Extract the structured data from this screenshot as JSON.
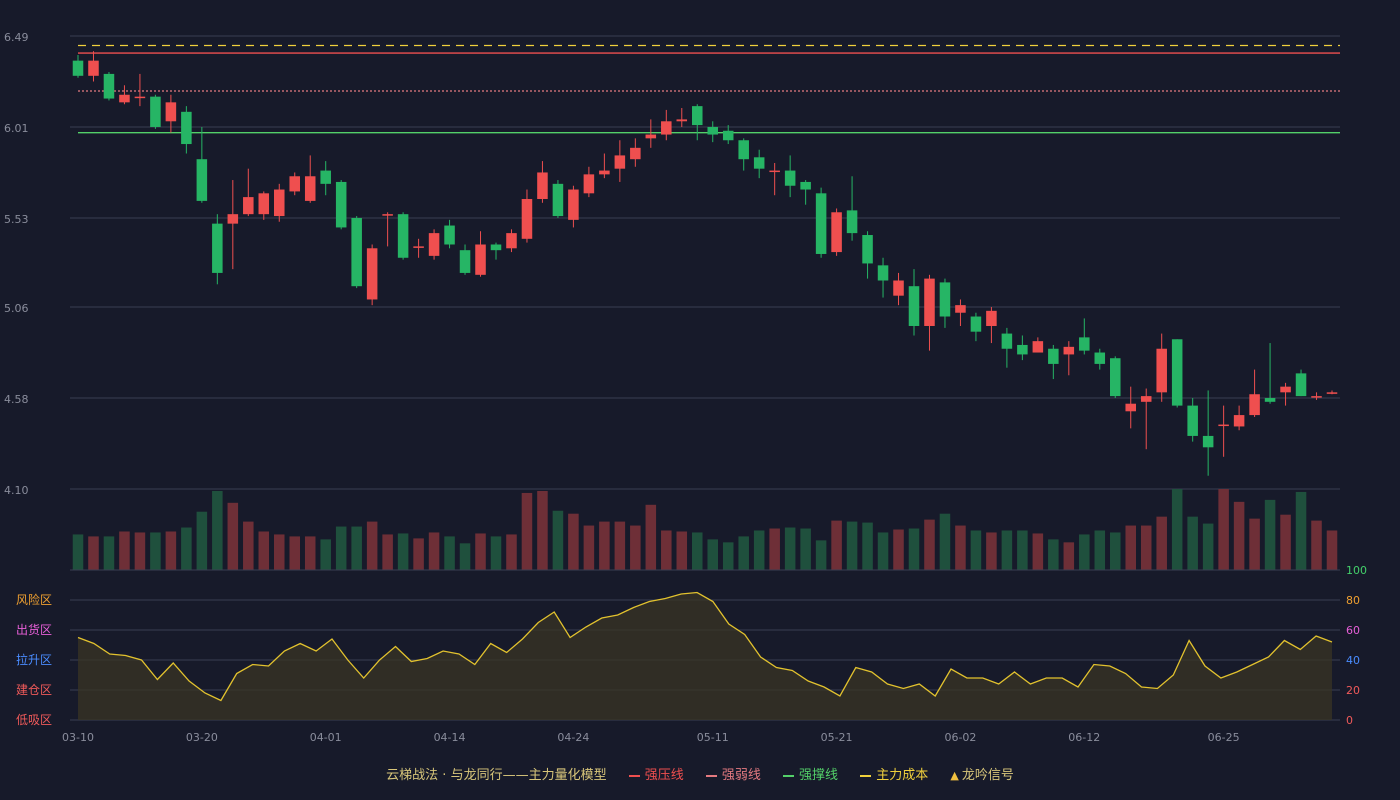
{
  "chart_data": {
    "type": "candlestick",
    "x": [
      "03-10",
      "03-11",
      "03-12",
      "03-13",
      "03-14",
      "03-17",
      "03-18",
      "03-19",
      "03-20",
      "03-21",
      "03-24",
      "03-25",
      "03-26",
      "03-27",
      "03-28",
      "03-31",
      "04-01",
      "04-02",
      "04-03",
      "04-07",
      "04-08",
      "04-09",
      "04-10",
      "04-11",
      "04-14",
      "04-15",
      "04-16",
      "04-17",
      "04-18",
      "04-21",
      "04-22",
      "04-23",
      "04-24",
      "04-25",
      "04-28",
      "04-29",
      "04-30",
      "05-06",
      "05-07",
      "05-08",
      "05-09",
      "05-11",
      "05-12",
      "05-13",
      "05-14",
      "05-15",
      "05-16",
      "05-19",
      "05-20",
      "05-21",
      "05-22",
      "05-23",
      "05-26",
      "05-27",
      "05-28",
      "05-29",
      "05-30",
      "06-02",
      "06-03",
      "06-04",
      "06-05",
      "06-06",
      "06-09",
      "06-10",
      "06-11",
      "06-12",
      "06-13",
      "06-16",
      "06-17",
      "06-18",
      "06-19",
      "06-20",
      "06-23",
      "06-24",
      "06-25",
      "06-26",
      "06-27",
      "06-30",
      "07-01",
      "07-02",
      "07-03",
      "07-04"
    ],
    "xticks": [
      "03-10",
      "03-20",
      "04-01",
      "04-14",
      "04-24",
      "05-11",
      "05-21",
      "06-02",
      "06-12",
      "06-25"
    ],
    "candles": [
      [
        6.36,
        6.28,
        6.39,
        6.27
      ],
      [
        6.28,
        6.36,
        6.41,
        6.25
      ],
      [
        6.29,
        6.16,
        6.3,
        6.15
      ],
      [
        6.14,
        6.18,
        6.23,
        6.13
      ],
      [
        6.17,
        6.17,
        6.29,
        6.12
      ],
      [
        6.17,
        6.01,
        6.18,
        6.0
      ],
      [
        6.04,
        6.14,
        6.18,
        5.98
      ],
      [
        6.09,
        5.92,
        6.12,
        5.87
      ],
      [
        5.84,
        5.62,
        6.01,
        5.61
      ],
      [
        5.5,
        5.24,
        5.55,
        5.18
      ],
      [
        5.5,
        5.55,
        5.73,
        5.26
      ],
      [
        5.55,
        5.64,
        5.79,
        5.54
      ],
      [
        5.55,
        5.66,
        5.67,
        5.52
      ],
      [
        5.54,
        5.68,
        5.71,
        5.51
      ],
      [
        5.67,
        5.75,
        5.77,
        5.65
      ],
      [
        5.62,
        5.75,
        5.86,
        5.61
      ],
      [
        5.78,
        5.71,
        5.83,
        5.65
      ],
      [
        5.72,
        5.48,
        5.73,
        5.47
      ],
      [
        5.53,
        5.17,
        5.54,
        5.16
      ],
      [
        5.1,
        5.37,
        5.39,
        5.07
      ],
      [
        5.55,
        5.55,
        5.56,
        5.38
      ],
      [
        5.55,
        5.32,
        5.56,
        5.31
      ],
      [
        5.38,
        5.38,
        5.42,
        5.32
      ],
      [
        5.33,
        5.45,
        5.47,
        5.31
      ],
      [
        5.49,
        5.39,
        5.52,
        5.37
      ],
      [
        5.36,
        5.24,
        5.39,
        5.23
      ],
      [
        5.23,
        5.39,
        5.46,
        5.22
      ],
      [
        5.39,
        5.36,
        5.4,
        5.31
      ],
      [
        5.37,
        5.45,
        5.47,
        5.35
      ],
      [
        5.42,
        5.63,
        5.68,
        5.4
      ],
      [
        5.63,
        5.77,
        5.83,
        5.61
      ],
      [
        5.71,
        5.54,
        5.73,
        5.53
      ],
      [
        5.52,
        5.68,
        5.7,
        5.48
      ],
      [
        5.66,
        5.76,
        5.8,
        5.64
      ],
      [
        5.76,
        5.78,
        5.87,
        5.74
      ],
      [
        5.79,
        5.86,
        5.94,
        5.72
      ],
      [
        5.84,
        5.9,
        5.95,
        5.8
      ],
      [
        5.95,
        5.97,
        6.05,
        5.9
      ],
      [
        5.97,
        6.04,
        6.1,
        5.94
      ],
      [
        6.04,
        6.05,
        6.11,
        6.01
      ],
      [
        6.12,
        6.02,
        6.13,
        5.94
      ],
      [
        6.01,
        5.97,
        6.04,
        5.93
      ],
      [
        5.99,
        5.94,
        6.02,
        5.92
      ],
      [
        5.94,
        5.84,
        5.95,
        5.78
      ],
      [
        5.85,
        5.79,
        5.89,
        5.74
      ],
      [
        5.78,
        5.78,
        5.82,
        5.65
      ],
      [
        5.78,
        5.7,
        5.86,
        5.64
      ],
      [
        5.72,
        5.68,
        5.73,
        5.6
      ],
      [
        5.66,
        5.34,
        5.69,
        5.32
      ],
      [
        5.35,
        5.56,
        5.58,
        5.33
      ],
      [
        5.57,
        5.45,
        5.75,
        5.41
      ],
      [
        5.44,
        5.29,
        5.46,
        5.21
      ],
      [
        5.28,
        5.2,
        5.32,
        5.11
      ],
      [
        5.12,
        5.2,
        5.24,
        5.07
      ],
      [
        5.17,
        4.96,
        5.26,
        4.91
      ],
      [
        4.96,
        5.21,
        5.23,
        4.83
      ],
      [
        5.19,
        5.01,
        5.21,
        4.95
      ],
      [
        5.03,
        5.07,
        5.1,
        4.96
      ],
      [
        5.01,
        4.93,
        5.03,
        4.88
      ],
      [
        4.96,
        5.04,
        5.06,
        4.87
      ],
      [
        4.92,
        4.84,
        4.95,
        4.74
      ],
      [
        4.86,
        4.81,
        4.91,
        4.78
      ],
      [
        4.82,
        4.88,
        4.9,
        4.82
      ],
      [
        4.84,
        4.76,
        4.86,
        4.68
      ],
      [
        4.81,
        4.85,
        4.88,
        4.7
      ],
      [
        4.9,
        4.83,
        5.0,
        4.81
      ],
      [
        4.82,
        4.76,
        4.84,
        4.73
      ],
      [
        4.79,
        4.59,
        4.8,
        4.58
      ],
      [
        4.51,
        4.55,
        4.64,
        4.42
      ],
      [
        4.56,
        4.59,
        4.63,
        4.31
      ],
      [
        4.61,
        4.84,
        4.92,
        4.56
      ],
      [
        4.89,
        4.54,
        4.89,
        4.53
      ],
      [
        4.54,
        4.38,
        4.58,
        4.35
      ],
      [
        4.38,
        4.32,
        4.62,
        4.17
      ],
      [
        4.44,
        4.44,
        4.54,
        4.27
      ],
      [
        4.43,
        4.49,
        4.54,
        4.41
      ],
      [
        4.49,
        4.6,
        4.73,
        4.48
      ],
      [
        4.58,
        4.56,
        4.87,
        4.55
      ],
      [
        4.61,
        4.64,
        4.66,
        4.54
      ],
      [
        4.71,
        4.59,
        4.73,
        4.59
      ],
      [
        4.59,
        4.59,
        4.61,
        4.57
      ],
      [
        4.61,
        4.61,
        4.62,
        4.6
      ]
    ],
    "volume": [
      36,
      34,
      34,
      39,
      38,
      38,
      39,
      43,
      59,
      80,
      68,
      49,
      39,
      36,
      34,
      34,
      31,
      44,
      44,
      49,
      36,
      37,
      32,
      38,
      34,
      27,
      37,
      34,
      36,
      78,
      80,
      60,
      57,
      45,
      49,
      49,
      45,
      66,
      40,
      39,
      38,
      31,
      28,
      34,
      40,
      42,
      43,
      42,
      30,
      50,
      49,
      48,
      38,
      41,
      42,
      51,
      57,
      45,
      40,
      38,
      40,
      40,
      37,
      31,
      28,
      36,
      40,
      38,
      45,
      45,
      54,
      82,
      54,
      47,
      82,
      69,
      52,
      71,
      56,
      79,
      50,
      40
    ],
    "ylim": [
      4.1,
      6.49
    ],
    "yticks": [
      6.49,
      6.01,
      5.53,
      5.06,
      4.58,
      4.1
    ],
    "lines": [
      {
        "name": "强压线",
        "value": 6.4,
        "color": "#ef4f4f",
        "style": "solid"
      },
      {
        "name": "强弱线",
        "value": 6.2,
        "color": "#e47a80",
        "style": "dotted"
      },
      {
        "name": "强撑线",
        "value": 5.98,
        "color": "#53d069",
        "style": "solid"
      },
      {
        "name": "主力成本",
        "value": 6.44,
        "color": "#f0d03c",
        "style": "dashed"
      }
    ],
    "indicator": {
      "values": [
        55,
        51,
        44,
        43,
        40,
        27,
        38,
        26,
        18,
        13,
        31,
        37,
        36,
        46,
        51,
        46,
        54,
        40,
        28,
        40,
        49,
        39,
        41,
        46,
        44,
        37,
        51,
        45,
        54,
        65,
        72,
        55,
        62,
        68,
        70,
        75,
        79,
        81,
        84,
        85,
        79,
        64,
        57,
        42,
        35,
        33,
        26,
        22,
        16,
        35,
        32,
        24,
        21,
        24,
        16,
        34,
        28,
        28,
        24,
        32,
        24,
        28,
        28,
        22,
        37,
        36,
        31,
        22,
        21,
        30,
        53,
        36,
        28,
        32,
        37,
        42,
        53,
        47,
        56,
        52
      ],
      "ylim": [
        0,
        100
      ],
      "yticks": [
        100,
        80,
        60,
        40,
        20,
        0
      ],
      "ytick_colors": [
        "#43d06a",
        "#f0a030",
        "#e85fd8",
        "#4a8cff",
        "#f05a5a",
        "#f05a5a"
      ],
      "zones": [
        {
          "label": "风险区",
          "color": "#f0a030",
          "level": 80
        },
        {
          "label": "出货区",
          "color": "#e85fd8",
          "level": 60
        },
        {
          "label": "拉升区",
          "color": "#4a8cff",
          "level": 40
        },
        {
          "label": "建仓区",
          "color": "#f05a5a",
          "level": 20
        },
        {
          "label": "低吸区",
          "color": "#f05a5a",
          "level": 0
        }
      ]
    },
    "colors": {
      "up": "#ef4f4f",
      "down": "#26b565",
      "up_volume": "#6e2f37",
      "down_volume": "#1f503d",
      "line": "#e2c22e",
      "grid": "#3a3e52",
      "background": "#171a2a"
    },
    "grid": true
  },
  "legend": {
    "title": "云梯战法 · 与龙同行——主力量化模型",
    "items": [
      {
        "label": "强压线",
        "color": "#ef4f4f",
        "style": "solid"
      },
      {
        "label": "强弱线",
        "color": "#e47a80",
        "style": "dashed"
      },
      {
        "label": "强撑线",
        "color": "#53d069",
        "style": "solid"
      },
      {
        "label": "主力成本",
        "color": "#f0d03c",
        "style": "dashed"
      },
      {
        "label": "龙吟信号",
        "color": "#f0c040",
        "style": "triangle"
      }
    ]
  }
}
